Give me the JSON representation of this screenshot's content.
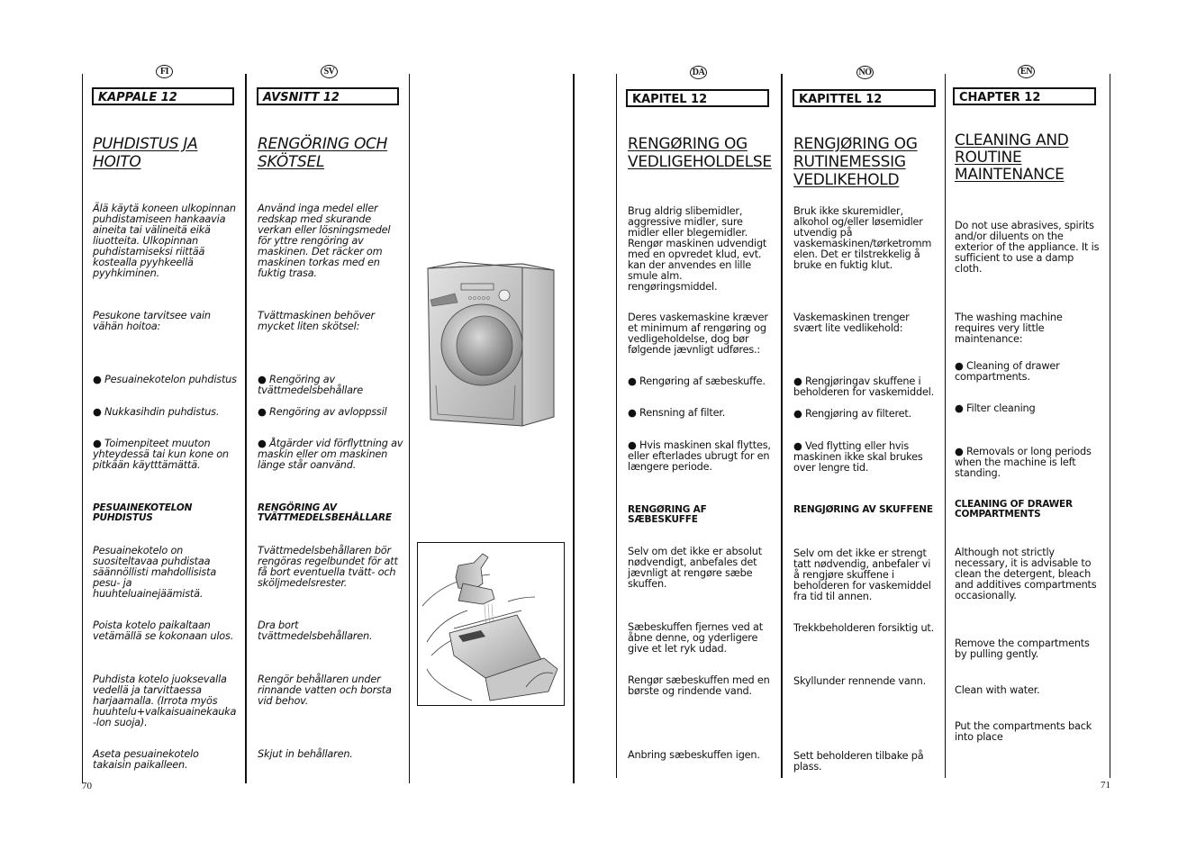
{
  "pages": {
    "left_number": "70",
    "right_number": "71"
  },
  "columns": {
    "fi": {
      "lang": "FI",
      "chapter": "KAPPALE 12",
      "title_line1": "PUHDISTUS JA",
      "title_line2": "HOITO",
      "intro": "Älä käytä koneen ulkopinnan puhdistamiseen hankaavia aineita tai välineitä eikä liuotteita. Ulkopinnan puhdistamiseksi riittää kostealla pyyhkeellä pyyhkiminen.",
      "lead": "Pesukone tarvitsee vain vähän hoitoa:",
      "bullets": [
        "● Pesuainekotelon puhdistus",
        "● Nukkasihdin puhdistus.",
        "● Toimenpiteet muuton yhteydessä tai kun kone on pitkään käytttämättä."
      ],
      "subheading": "PESUAINEKOTELON PUHDISTUS",
      "steps": [
        "Pesuainekotelo on suositeltavaa puhdistaa säännöllisti mahdollisista pesu- ja huuhteluainejäämistä.",
        "Poista kotelo paikaltaan vetämällä se kokonaan ulos.",
        "Puhdista kotelo juoksevalla vedellä ja tarvittaessa harjaamalla. (Irrota myös huuhtelu+valkaisuainekauka -lon suoja).",
        "Aseta pesuainekotelo takaisin paikalleen."
      ]
    },
    "sv": {
      "lang": "SV",
      "chapter": "AVSNITT 12",
      "title_line1": "RENGÖRING OCH",
      "title_line2": "SKÖTSEL",
      "intro": "Använd inga medel eller redskap med skurande verkan eller lösningsmedel för yttre rengöring av maskinen. Det räcker om maskinen torkas med en fuktig trasa.",
      "lead": "Tvättmaskinen behöver mycket liten skötsel:",
      "bullets": [
        "● Rengöring av tvättmedelsbehållare",
        "● Rengöring av avloppssil",
        "● Åtgärder vid förflyttning av maskin eller om maskinen länge står oanvänd."
      ],
      "subheading": "RENGÖRING AV TVÄTTMEDELSBEHÅLLARE",
      "steps": [
        "Tvättmedelsbehållaren bör rengöras regelbundet för att få bort eventuella tvätt- och sköljmedelsrester.",
        "Dra bort tvättmedelsbehållaren.",
        "Rengör behållaren under rinnande vatten och borsta vid behov.",
        "Skjut in behållaren."
      ]
    },
    "da": {
      "lang": "DA",
      "chapter": "KAPITEL 12",
      "title_line1": "RENGØRING OG",
      "title_line2": "VEDLIGEHOLDELSE",
      "intro": "Brug aldrig slibemidler, aggressive midler, sure midler eller blegemidler. Rengør maskinen udvendigt med en opvredet klud, evt. kan der anvendes en lille smule alm. rengøringsmiddel.",
      "lead": "Deres vaskemaskine kræver et minimum af rengøring og vedligeholdelse, dog bør følgende jævnligt udføres.:",
      "bullets": [
        "● Rengøring af sæbeskuffe.",
        "● Rensning af filter.",
        "● Hvis maskinen skal flyttes, eller efterlades ubrugt for en længere periode."
      ],
      "subheading": "RENGØRING AF SÆBESKUFFE",
      "steps": [
        "Selv om det ikke er absolut nødvendigt, anbefales det jævnligt at rengøre sæbe skuffen.",
        "Sæbeskuffen fjernes ved at åbne denne, og yderligere give et let ryk udad.",
        "Rengør sæbeskuffen med en børste og rindende vand.",
        "Anbring sæbeskuffen igen."
      ]
    },
    "no": {
      "lang": "NO",
      "chapter": "KAPITTEL 12",
      "title_line1": "RENGJØRING OG",
      "title_line2": "RUTINEMESSIG",
      "title_line3": "VEDLIKEHOLD",
      "intro": "Bruk ikke skuremidler, alkohol og/eller løsemidler utvendig på vaskemaskinen/tørketromm elen. Det er tilstrekkelig å bruke en fuktig klut.",
      "lead": "Vaskemaskinen trenger svært lite vedlikehold:",
      "bullets": [
        "● Rengjøringav skuffene i beholderen for vaskemiddel.",
        "● Rengjøring av filteret.",
        "● Ved flytting eller hvis maskinen ikke skal brukes over lengre tid."
      ],
      "subheading": "RENGJØRING AV SKUFFENE",
      "steps": [
        "Selv om det ikke er strengt tatt nødvendig, anbefaler vi å rengjøre skuffene i beholderen for vaskemiddel fra tid til annen.",
        "Trekkbeholderen forsiktig ut.",
        "Skyllunder rennende vann.",
        "Sett beholderen tilbake på plass."
      ]
    },
    "en": {
      "lang": "EN",
      "chapter": "CHAPTER 12",
      "title_line1": "CLEANING AND",
      "title_line2": "ROUTINE",
      "title_line3": "MAINTENANCE",
      "intro": "Do not use abrasives, spirits and/or diluents on the exterior of the appliance. It is sufficient to use a damp cloth.",
      "lead": "The washing machine requires very little maintenance:",
      "bullets": [
        "● Cleaning of drawer compartments.",
        "● Filter cleaning",
        "● Removals or long periods when the machine is left standing."
      ],
      "subheading": "CLEANING OF DRAWER COMPARTMENTS",
      "steps": [
        "Although not strictly necessary, it is advisable to clean the detergent, bleach and additives compartments occasionally.",
        "Remove the compartments by pulling gently.",
        "Clean with water.",
        "Put the compartments back into place"
      ]
    }
  },
  "figures": {
    "washing_machine": "washing-machine-illustration",
    "drawer_cleaning": "detergent-drawer-under-tap-illustration"
  }
}
